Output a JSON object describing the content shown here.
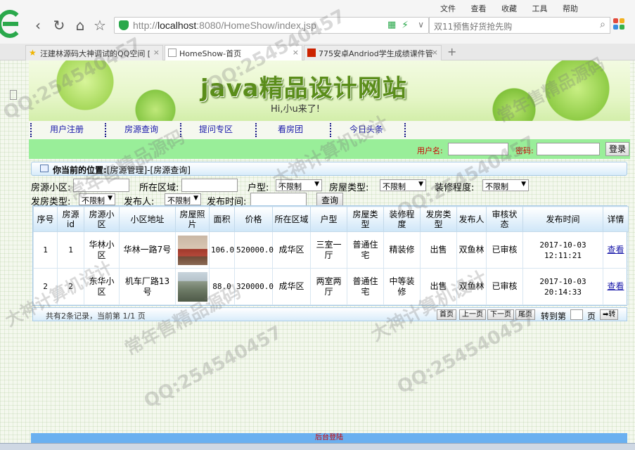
{
  "browser": {
    "menu": [
      "文件",
      "查看",
      "收藏",
      "工具",
      "帮助"
    ],
    "address_scheme": "http://",
    "address_host": "localhost",
    "address_rest": ":8080/HomeShow/index.jsp",
    "search_text": "双11预售好货抢先购",
    "tabs": [
      {
        "label": "汪建林源码大神调试的QQ空间 [",
        "active": false,
        "icon_color": "#f0b400"
      },
      {
        "label": "HomeShow-首页",
        "active": true,
        "icon_color": "#999999"
      },
      {
        "label": "775安卓Andriod学生成绩课件管",
        "active": false,
        "icon_color": "#cc2200"
      }
    ],
    "tab_close": "×",
    "new_tab": "+"
  },
  "site": {
    "title": "java精品设计网站",
    "subtitle": "Hi,小u来了!",
    "nav": [
      "用户注册",
      "房源查询",
      "提问专区",
      "看房团",
      "今日头条"
    ]
  },
  "login": {
    "username_label": "用户名:",
    "password_label": "密码:",
    "button": "登录"
  },
  "breadcrumb": {
    "prefix": "你当前的位置:",
    "path": "[房源管理]-[房源查询]"
  },
  "filters": {
    "community_label": "房源小区:",
    "area_label": "所在区域:",
    "layout_label": "户型:",
    "layout_value": "不限制",
    "type_label": "房屋类型:",
    "type_value": "不限制",
    "decor_label": "装修程度:",
    "decor_value": "不限制",
    "publish_type_label": "发房类型:",
    "publish_type_value": "不限制",
    "publisher_label": "发布人:",
    "publisher_value": "不限制",
    "time_label": "发布时间:",
    "query_button": "查询"
  },
  "table": {
    "headers": [
      "序号",
      "房源id",
      "房源小区",
      "小区地址",
      "房屋照片",
      "面积",
      "价格",
      "所在区域",
      "户型",
      "房屋类型",
      "装修程度",
      "发房类型",
      "发布人",
      "审核状态",
      "发布时间",
      "详情"
    ],
    "rows": [
      {
        "no": "1",
        "id": "1",
        "community": "华林小区",
        "address": "华林一路7号",
        "area": "106.0",
        "price": "520000.0",
        "region": "成华区",
        "layout": "三室一厅",
        "type": "普通住宅",
        "decor": "精装修",
        "ptype": "出售",
        "publisher": "双鱼林",
        "status": "已审核",
        "date": "2017-10-03",
        "time": "12:11:21",
        "detail": "查看",
        "photo": "room-photo"
      },
      {
        "no": "2",
        "id": "2",
        "community": "东华小区",
        "address": "机车厂路13号",
        "area": "88.0",
        "price": "320000.0",
        "region": "成华区",
        "layout": "两室两厅",
        "type": "普通住宅",
        "decor": "中等装修",
        "ptype": "出售",
        "publisher": "双鱼林",
        "status": "已审核",
        "date": "2017-10-03",
        "time": "20:14:33",
        "detail": "查看",
        "photo": "building-photo"
      }
    ]
  },
  "pager": {
    "summary": "共有2条记录，当前第 1/1 页",
    "first": "首页",
    "prev": "上一页",
    "next": "下一页",
    "last": "尾页",
    "goto_label": "转到第",
    "page_unit": "页",
    "go_button": "➡转"
  },
  "footer": {
    "link": "后台登陆"
  },
  "watermarks": [
    "QQ:254540457",
    "常年售精品源码",
    "大神计算机设计"
  ]
}
